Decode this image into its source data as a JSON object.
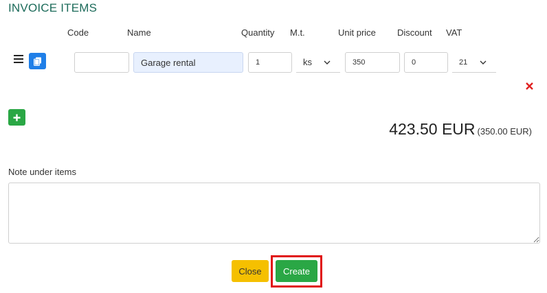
{
  "section": {
    "title": "INVOICE ITEMS"
  },
  "columns": {
    "code": "Code",
    "name": "Name",
    "quantity": "Quantity",
    "unit": "M.t.",
    "unit_price": "Unit price",
    "discount": "Discount",
    "vat": "VAT"
  },
  "item": {
    "code": "",
    "name": "Garage rental",
    "quantity": "1",
    "unit": "ks",
    "unit_price": "350",
    "discount": "0",
    "vat": "21"
  },
  "icons": {
    "menu": "hamburger-icon",
    "copy": "copy-icon",
    "remove": "close-icon",
    "add": "plus-icon",
    "dropdown": "chevron-down-icon"
  },
  "total": {
    "gross": "423.50 EUR",
    "net": "(350.00 EUR)"
  },
  "note": {
    "label": "Note under items",
    "value": ""
  },
  "buttons": {
    "close": "Close",
    "create": "Create"
  },
  "colors": {
    "title": "#1c6b5a",
    "primary": "#1f7fe8",
    "success": "#2aa745",
    "warning": "#f5c000",
    "danger": "#e02020",
    "highlight": "#e01010"
  }
}
